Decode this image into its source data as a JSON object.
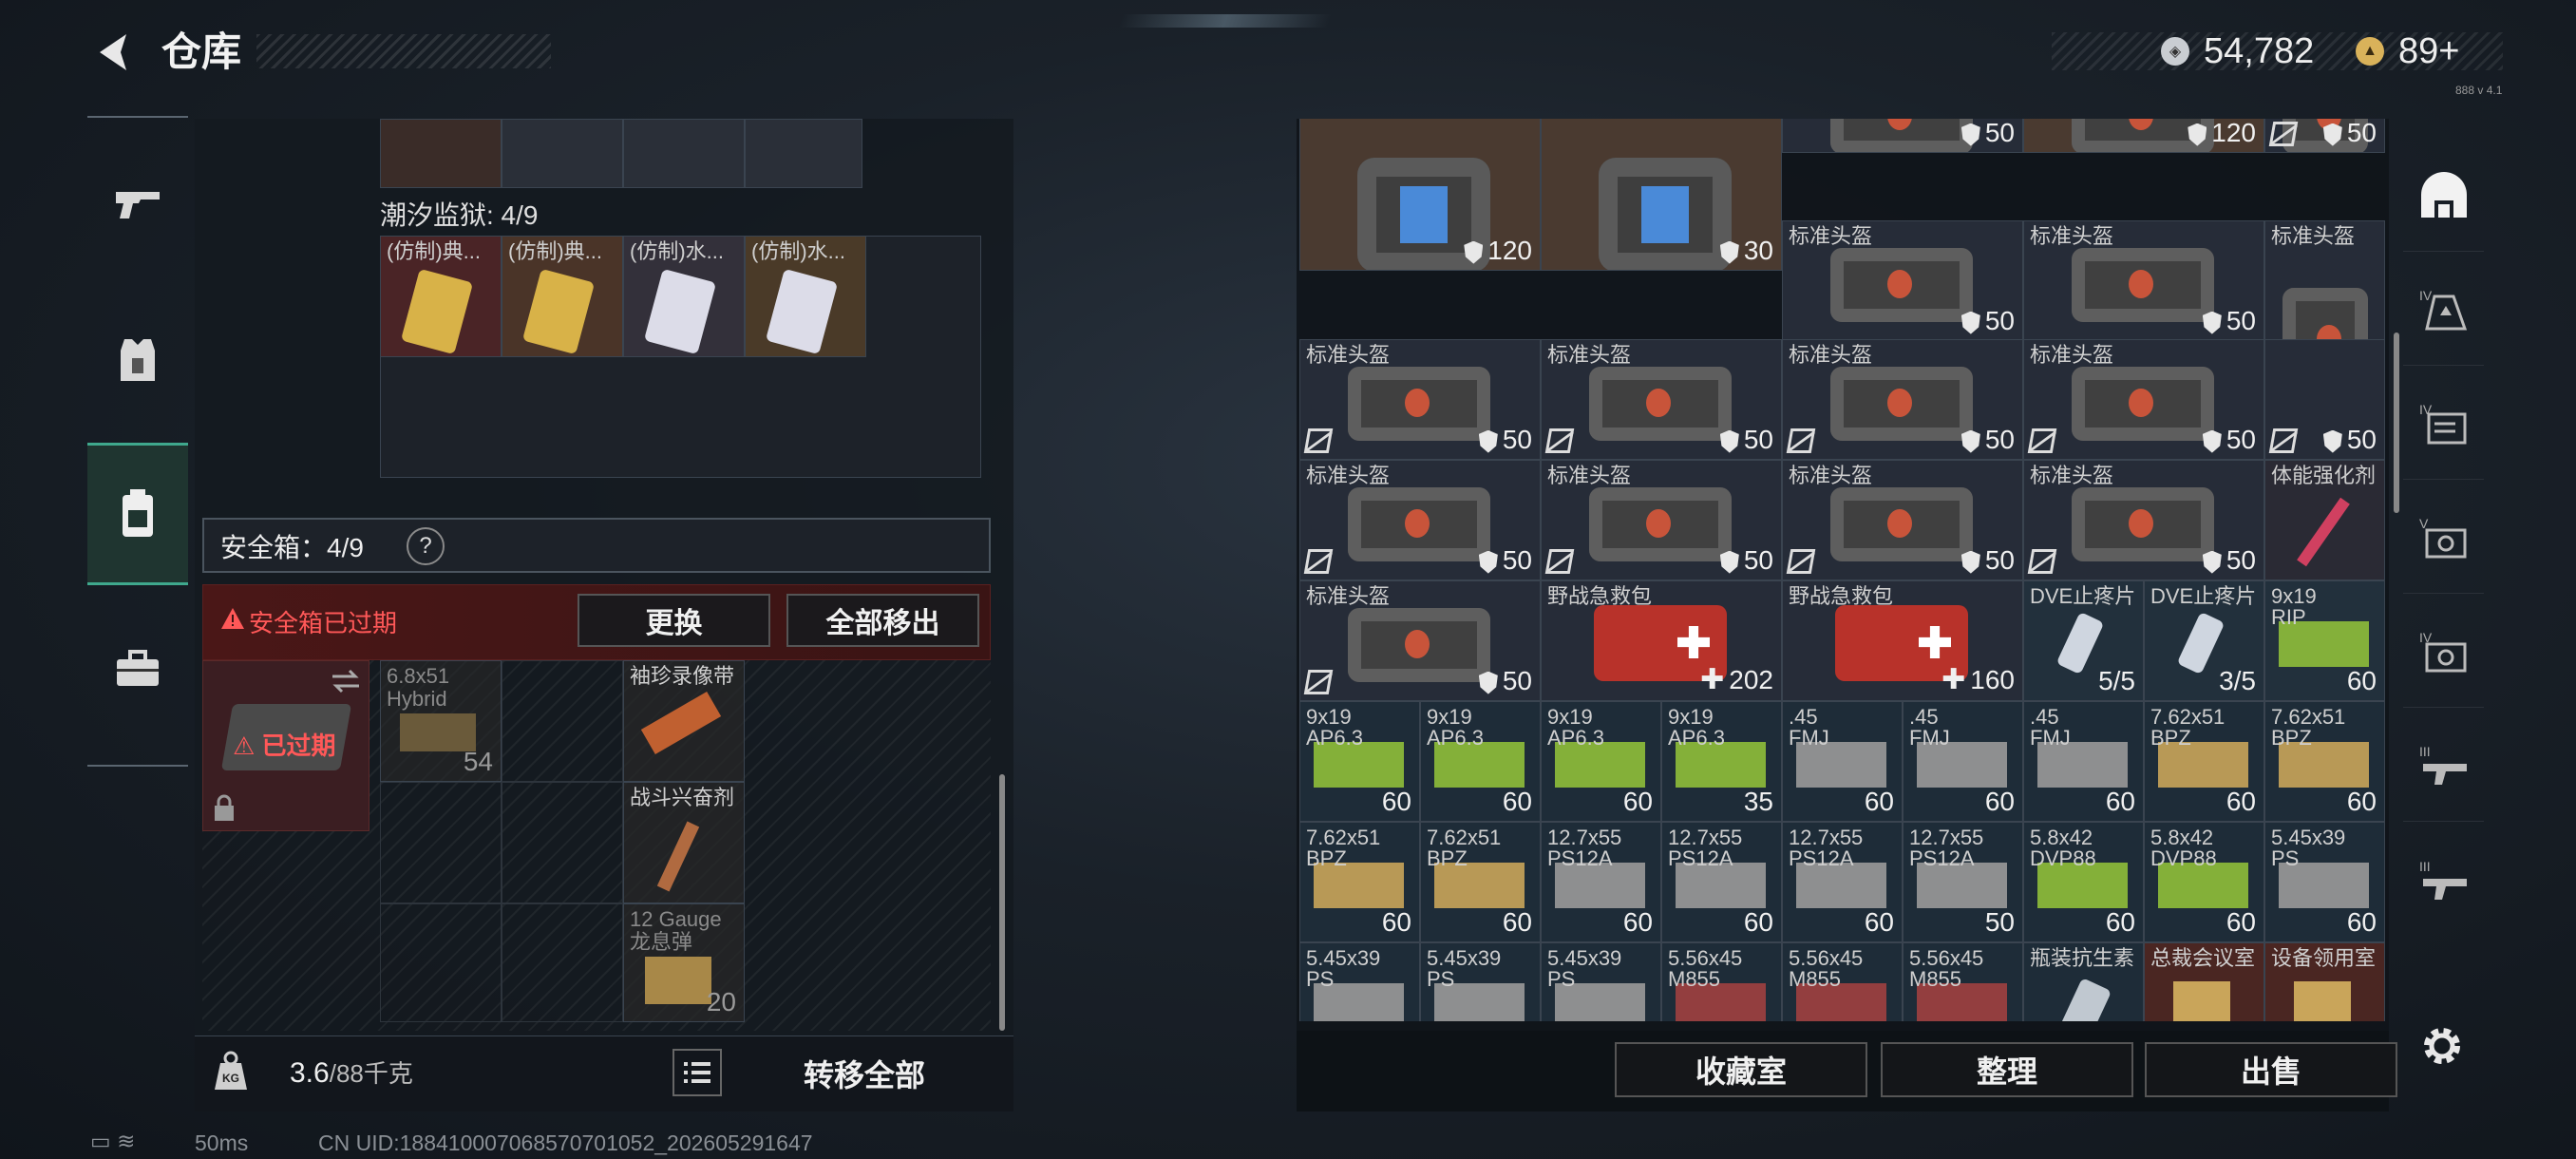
{
  "header": {
    "title": "仓库"
  },
  "currency": [
    {
      "icon": "silver-coin-icon",
      "value": "54,782"
    },
    {
      "icon": "gold-coin-icon",
      "value": "89+"
    }
  ],
  "top_right_small": "888 v 4.1",
  "left_tabs": [
    {
      "name": "gun-icon"
    },
    {
      "name": "armor-vest-icon"
    },
    {
      "name": "backpack-icon",
      "active": true
    },
    {
      "name": "briefcase-icon"
    }
  ],
  "left_panel": {
    "section_label": "潮汐监狱: 4/9",
    "items_row": [
      {
        "label": "(仿制)典...",
        "color": "#d8b248"
      },
      {
        "label": "(仿制)典...",
        "color": "#d8b248"
      },
      {
        "label": "(仿制)水...",
        "color": "#c8c8e8"
      },
      {
        "label": "(仿制)水...",
        "color": "#c8c8e8"
      }
    ],
    "safe_box_label": "安全箱：4/9",
    "help": "?",
    "expired_warning": "安全箱已过期",
    "btn_replace": "更换",
    "btn_move_all": "全部移出",
    "safe_box_expired": "已过期",
    "safe_items": [
      {
        "label": "6.8x51",
        "sub": "Hybrid",
        "count": "54"
      },
      {
        "label": "袖珍录像带",
        "count": ""
      },
      {
        "label": "战斗兴奋剂",
        "count": ""
      },
      {
        "label": "12 Gauge",
        "sub": "龙息弹",
        "count": "20"
      }
    ],
    "weight_main": "3.6",
    "weight_rest": "/88千克",
    "transfer_all": "转移全部"
  },
  "right_grid": [
    [
      {
        "label": "",
        "count": "120",
        "kind": "shield",
        "bg": "#4a3a30",
        "art": "big-bag"
      },
      {
        "label": "",
        "count": "30",
        "kind": "shield",
        "bg": "#4a3a30",
        "art": "big-bag"
      },
      {
        "label": "",
        "count": "50",
        "kind": "shield",
        "bg": "#262c38",
        "art": "helmet"
      },
      {
        "label": "",
        "count": "120",
        "kind": "shield",
        "bg": "#4a3a30",
        "art": "helmet"
      },
      {
        "label": "",
        "count": "50",
        "kind": "shield",
        "bg": "#262c38",
        "art": "helmet",
        "broken": true
      }
    ],
    [
      {
        "label": "标准头盔",
        "count": "50",
        "kind": "shield",
        "bg": "#262c38",
        "art": "helmet"
      },
      {
        "label": "标准头盔",
        "count": "50",
        "kind": "shield",
        "bg": "#262c38",
        "art": "helmet"
      },
      {
        "label": "标准头盔",
        "count": "",
        "kind": "",
        "bg": "#262c38",
        "art": "helmet"
      }
    ],
    [
      {
        "label": "标准头盔",
        "count": "50",
        "kind": "shield",
        "bg": "#262c38",
        "art": "helmet",
        "broken": true
      },
      {
        "label": "标准头盔",
        "count": "50",
        "kind": "shield",
        "bg": "#262c38",
        "art": "helmet",
        "broken": true
      },
      {
        "label": "标准头盔",
        "count": "50",
        "kind": "shield",
        "bg": "#262c38",
        "art": "helmet",
        "broken": true
      },
      {
        "label": "标准头盔",
        "count": "50",
        "kind": "shield",
        "bg": "#262c38",
        "art": "helmet",
        "broken": true
      },
      {
        "label": "",
        "count": "50",
        "kind": "shield",
        "bg": "#262c38",
        "art": "",
        "broken": true
      }
    ],
    [
      {
        "label": "标准头盔",
        "count": "50",
        "kind": "shield",
        "bg": "#262c38",
        "art": "helmet",
        "broken": true
      },
      {
        "label": "标准头盔",
        "count": "50",
        "kind": "shield",
        "bg": "#262c38",
        "art": "helmet",
        "broken": true
      },
      {
        "label": "标准头盔",
        "count": "50",
        "kind": "shield",
        "bg": "#262c38",
        "art": "helmet",
        "broken": true
      },
      {
        "label": "标准头盔",
        "count": "50",
        "kind": "shield",
        "bg": "#262c38",
        "art": "helmet",
        "broken": true
      },
      {
        "label": "体能强化剂",
        "count": "",
        "kind": "",
        "bg": "#2a2a34",
        "art": "syringe"
      }
    ],
    [
      {
        "label": "标准头盔",
        "count": "50",
        "kind": "shield",
        "bg": "#262c38",
        "art": "helmet",
        "broken": true
      },
      {
        "label": "野战急救包",
        "count": "202",
        "kind": "plus",
        "bg": "#262c38",
        "art": "medkit"
      },
      {
        "label": "野战急救包",
        "count": "160",
        "kind": "plus",
        "bg": "#262c38",
        "art": "medkit"
      },
      {
        "label": "DVE止疼片",
        "count": "5/5",
        "kind": "",
        "bg": "#22303c",
        "art": "pill"
      },
      {
        "label": "DVE止疼片",
        "count": "3/5",
        "kind": "",
        "bg": "#22303c",
        "art": "pill"
      },
      {
        "label": "9x19",
        "sub": "RIP",
        "count": "60",
        "kind": "",
        "bg": "#22303c",
        "art": "ammo-green"
      }
    ],
    [
      {
        "label": "9x19",
        "sub": "AP6.3",
        "count": "60",
        "art": "ammo-green"
      },
      {
        "label": "9x19",
        "sub": "AP6.3",
        "count": "60",
        "art": "ammo-green"
      },
      {
        "label": "9x19",
        "sub": "AP6.3",
        "count": "60",
        "art": "ammo-green"
      },
      {
        "label": "9x19",
        "sub": "AP6.3",
        "count": "35",
        "art": "ammo-green"
      },
      {
        "label": ".45",
        "sub": "FMJ",
        "count": "60",
        "art": "ammo-gray"
      },
      {
        "label": ".45",
        "sub": "FMJ",
        "count": "60",
        "art": "ammo-gray"
      },
      {
        "label": ".45",
        "sub": "FMJ",
        "count": "60",
        "art": "ammo-gray"
      },
      {
        "label": "7.62x51",
        "sub": "BPZ",
        "count": "60",
        "art": "ammo-tan"
      },
      {
        "label": "7.62x51",
        "sub": "BPZ",
        "count": "60",
        "art": "ammo-tan"
      }
    ],
    [
      {
        "label": "7.62x51",
        "sub": "BPZ",
        "count": "60",
        "art": "ammo-tan"
      },
      {
        "label": "7.62x51",
        "sub": "BPZ",
        "count": "60",
        "art": "ammo-tan"
      },
      {
        "label": "12.7x55",
        "sub": "PS12A",
        "count": "60",
        "art": "ammo-gray"
      },
      {
        "label": "12.7x55",
        "sub": "PS12A",
        "count": "60",
        "art": "ammo-gray"
      },
      {
        "label": "12.7x55",
        "sub": "PS12A",
        "count": "60",
        "art": "ammo-gray"
      },
      {
        "label": "12.7x55",
        "sub": "PS12A",
        "count": "50",
        "art": "ammo-gray"
      },
      {
        "label": "5.8x42",
        "sub": "DVP88",
        "count": "60",
        "art": "ammo-green"
      },
      {
        "label": "5.8x42",
        "sub": "DVP88",
        "count": "60",
        "art": "ammo-green"
      },
      {
        "label": "5.45x39",
        "sub": "PS",
        "count": "60",
        "art": "ammo-gray"
      }
    ],
    [
      {
        "label": "5.45x39",
        "sub": "PS",
        "count": "",
        "art": "ammo-gray"
      },
      {
        "label": "5.45x39",
        "sub": "PS",
        "count": "",
        "art": "ammo-gray"
      },
      {
        "label": "5.45x39",
        "sub": "PS",
        "count": "",
        "art": "ammo-gray"
      },
      {
        "label": "5.56x45",
        "sub": "M855",
        "count": "",
        "art": "ammo-red"
      },
      {
        "label": "5.56x45",
        "sub": "M855",
        "count": "",
        "art": "ammo-red"
      },
      {
        "label": "5.56x45",
        "sub": "M855",
        "count": "",
        "art": "ammo-red"
      },
      {
        "label": "瓶装抗生素",
        "count": "",
        "art": "bottle"
      },
      {
        "label": "总裁会议室",
        "count": "",
        "art": "key",
        "bg": "#4a2622"
      },
      {
        "label": "设备领用室",
        "count": "",
        "art": "key",
        "bg": "#4a2622"
      }
    ]
  ],
  "right_buttons": [
    "收藏室",
    "整理",
    "出售"
  ],
  "right_tabs": [
    "helmet-tab-icon",
    "IV-armor-icon",
    "IV-folder-icon",
    "V-camera-icon",
    "IV-camera-icon",
    "III-gun-icon",
    "III-gun-icon"
  ],
  "status": {
    "latency": "50ms",
    "uid": "CN UID:1884100070685707010​52_202605291647"
  }
}
